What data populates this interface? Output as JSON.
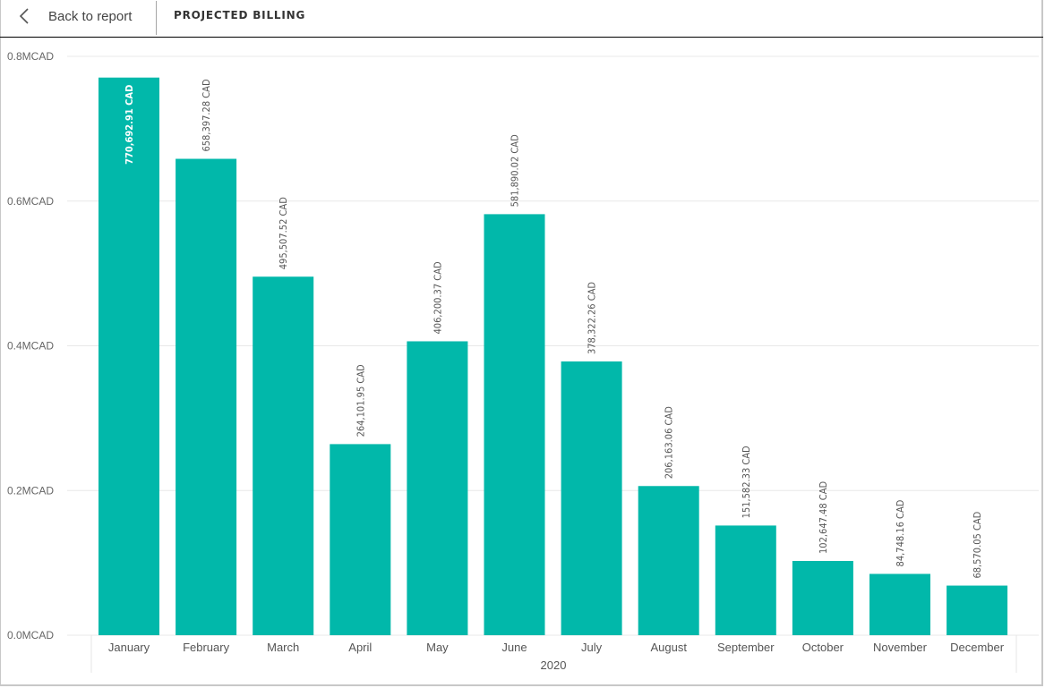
{
  "header": {
    "back_label": "Back to report",
    "back_icon": "chevron-left-icon",
    "title": "PROJECTED BILLING"
  },
  "colors": {
    "bar": "#01B8AA",
    "grid": "#e8e8e8",
    "header_rule": "#000000"
  },
  "chart_data": {
    "type": "bar",
    "title": "PROJECTED BILLING",
    "xlabel": "2020",
    "ylabel": "",
    "categories": [
      "January",
      "February",
      "March",
      "April",
      "May",
      "June",
      "July",
      "August",
      "September",
      "October",
      "November",
      "December"
    ],
    "values": [
      770692.91,
      658397.28,
      495507.52,
      264101.95,
      406200.37,
      581890.02,
      378322.26,
      206163.06,
      151582.33,
      102647.48,
      84748.16,
      68570.05
    ],
    "data_labels": [
      "770,692.91 CAD",
      "658,397.28 CAD",
      "495,507.52 CAD",
      "264,101.95 CAD",
      "406,200.37 CAD",
      "581,890.02 CAD",
      "378,322.26 CAD",
      "206,163.06 CAD",
      "151,582.33 CAD",
      "102,647.48 CAD",
      "84,748.16 CAD",
      "68,570.05 CAD"
    ],
    "yticks": [
      0,
      200000,
      400000,
      600000,
      800000
    ],
    "ytick_labels": [
      "0.0MCAD",
      "0.2MCAD",
      "0.4MCAD",
      "0.6MCAD",
      "0.8MCAD"
    ],
    "ylim": [
      0,
      800000
    ],
    "grid": true,
    "x_group_label": "2020",
    "legend": "none"
  }
}
